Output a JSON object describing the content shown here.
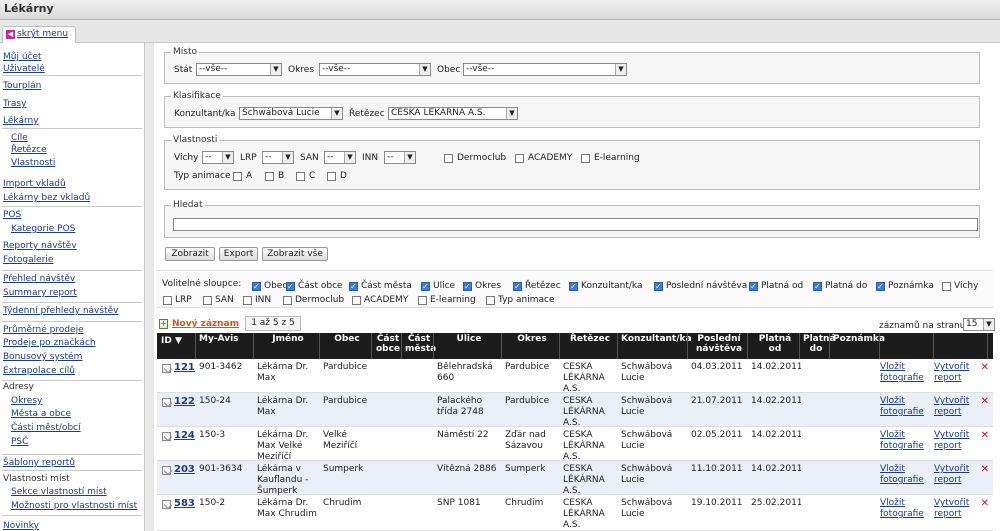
{
  "app": {
    "title": "Lékárny"
  },
  "sidebar": {
    "hide_label": "skrýt menu",
    "items": [
      {
        "label": "Můj účet"
      },
      {
        "label": "Uživatelé"
      },
      {
        "label": "Tourplán"
      },
      {
        "label": "Trasy"
      },
      {
        "label": "Lékárny"
      },
      {
        "label": "Cíle"
      },
      {
        "label": "Řetězce"
      },
      {
        "label": "Vlastnosti"
      },
      {
        "label": "Import vkladů"
      },
      {
        "label": "Lékárny bez vkladů"
      },
      {
        "label": "POS"
      },
      {
        "label": "Kategorie POS"
      },
      {
        "label": "Reporty návštěv"
      },
      {
        "label": "Fotogalerie"
      },
      {
        "label": "Přehled návštěv"
      },
      {
        "label": "Summary report"
      },
      {
        "label": "Týdenní přehledy návštěv"
      },
      {
        "label": "Průměrné prodeje"
      },
      {
        "label": "Prodeje po značkách"
      },
      {
        "label": "Bonusový systém"
      },
      {
        "label": "Extrapolace cílů"
      },
      {
        "label": "Adresy"
      },
      {
        "label": "Okresy"
      },
      {
        "label": "Města a obce"
      },
      {
        "label": "Části měst/obcí"
      },
      {
        "label": "PSČ"
      },
      {
        "label": "Šablony reportů"
      },
      {
        "label": "Vlastnosti míst"
      },
      {
        "label": "Sekce vlastností míst"
      },
      {
        "label": "Možnosti pro vlastnosti míst"
      },
      {
        "label": "Novinky"
      }
    ]
  },
  "filters": {
    "misto": {
      "legend": "Místo",
      "stat_label": "Stát",
      "stat_value": "--vše--",
      "okres_label": "Okres",
      "okres_value": "--vše--",
      "obec_label": "Obec",
      "obec_value": "--vše--"
    },
    "klasifikace": {
      "legend": "Klasifikace",
      "konzultant_label": "Konzultant/ka",
      "konzultant_value": "Schwábová Lucie",
      "retezec_label": "Řetězec",
      "retezec_value": "ČESKÁ LÉKÁRNA A.S."
    },
    "vlastnosti": {
      "legend": "Vlastnosti",
      "vichy_label": "Vichy",
      "lrp_label": "LRP",
      "san_label": "SAN",
      "inn_label": "INN",
      "dash": "--",
      "dermoclub_label": "Dermoclub",
      "academy_label": "ACADEMY",
      "elearning_label": "E-learning",
      "typ_animace_label": "Typ animace",
      "a": "A",
      "b": "B",
      "c": "C",
      "d": "D"
    },
    "hledat": {
      "legend": "Hledat",
      "value": ""
    }
  },
  "buttons": {
    "zobrazit": "Zobrazit",
    "export": "Export",
    "zobrazit_vse": "Zobrazit vše"
  },
  "columns_picker": {
    "label": "Volitelné sloupce:",
    "items": [
      {
        "label": "Obec",
        "checked": true
      },
      {
        "label": "Část obce",
        "checked": true
      },
      {
        "label": "Část města",
        "checked": true
      },
      {
        "label": "Ulice",
        "checked": true
      },
      {
        "label": "Okres",
        "checked": true
      },
      {
        "label": "Řetězec",
        "checked": true
      },
      {
        "label": "Konzultant/ka",
        "checked": true
      },
      {
        "label": "Poslední návštěva",
        "checked": true
      },
      {
        "label": "Platná od",
        "checked": true
      },
      {
        "label": "Platná do",
        "checked": true
      },
      {
        "label": "Poznámka",
        "checked": true
      },
      {
        "label": "Vichy",
        "checked": false
      },
      {
        "label": "LRP",
        "checked": false
      },
      {
        "label": "SAN",
        "checked": false
      },
      {
        "label": "INN",
        "checked": false
      },
      {
        "label": "Dermoclub",
        "checked": false
      },
      {
        "label": "ACADEMY",
        "checked": false
      },
      {
        "label": "E-learning",
        "checked": false
      },
      {
        "label": "Typ animace",
        "checked": false
      }
    ]
  },
  "toolbar": {
    "new_record": "Nový záznam",
    "pager_text": "1 až 5 z 5",
    "per_page_label": "záznamů na stranu",
    "per_page_value": "15"
  },
  "table": {
    "headers": {
      "id": "ID ▼",
      "myavis": "My-Avis",
      "jmeno": "Jméno",
      "obec": "Obec",
      "cast_obce": "Část obce",
      "cast_mesta": "Část města",
      "ulice": "Ulice",
      "okres": "Okres",
      "retezec": "Řetězec",
      "konzultant": "Konzultant/ka",
      "posledni": "Poslední návštěva",
      "platna_od": "Platná od",
      "platna_do": "Platná do",
      "poznamka": "Poznámka"
    },
    "photo_link": "Vložit fotografie",
    "report_link": "Vytvořit report",
    "rows": [
      {
        "id": "121",
        "myavis": "901-3462",
        "jmeno": "Lékárna Dr. Max",
        "obec": "Pardubice",
        "ulice": "Bělehradská 660",
        "okres": "Pardubice",
        "retezec": "ČESKÁ LÉKÁRNA A.S.",
        "konzultant": "Schwábová Lucie",
        "posledni": "04.03.2011",
        "platna_od": "14.02.2011"
      },
      {
        "id": "122",
        "myavis": "150-24",
        "jmeno": "Lékárna Dr. Max",
        "obec": "Pardubice",
        "ulice": "Palackého třída 2748",
        "okres": "Pardubice",
        "retezec": "ČESKÁ LÉKÁRNA A.S.",
        "konzultant": "Schwábová Lucie",
        "posledni": "21.07.2011",
        "platna_od": "14.02.2011"
      },
      {
        "id": "124",
        "myavis": "150-3",
        "jmeno": "Lékárna Dr. Max Velké Meziříčí",
        "obec": "Velké Meziříčí",
        "ulice": "Náměstí 22",
        "okres": "Žďár nad Sázavou",
        "retezec": "ČESKÁ LÉKÁRNA A.S.",
        "konzultant": "Schwábová Lucie",
        "posledni": "02.05.2011",
        "platna_od": "14.02.2011"
      },
      {
        "id": "203",
        "myavis": "901-3634",
        "jmeno": "Lékárna v Kauflandu - Šumperk",
        "obec": "Šumperk",
        "ulice": "Vítězná 2886",
        "okres": "Šumperk",
        "retezec": "ČESKÁ LÉKÁRNA A.S.",
        "konzultant": "Schwábová Lucie",
        "posledni": "11.10.2011",
        "platna_od": "14.02.2011"
      },
      {
        "id": "583",
        "myavis": "150-2",
        "jmeno": "Lékárna Dr. Max Chrudim",
        "obec": "Chrudim",
        "ulice": "SNP 1081",
        "okres": "Chrudim",
        "retezec": "ČESKÁ LÉKÁRNA A.S.",
        "konzultant": "Schwábová Lucie",
        "posledni": "19.10.2011",
        "platna_od": "25.02.2011"
      }
    ]
  },
  "colors": {
    "header_bg": "#1c1c1c",
    "row_alt": "#e9eef7",
    "link": "#1a3c8c",
    "new_record": "#d9531e",
    "delete": "#d11111"
  }
}
